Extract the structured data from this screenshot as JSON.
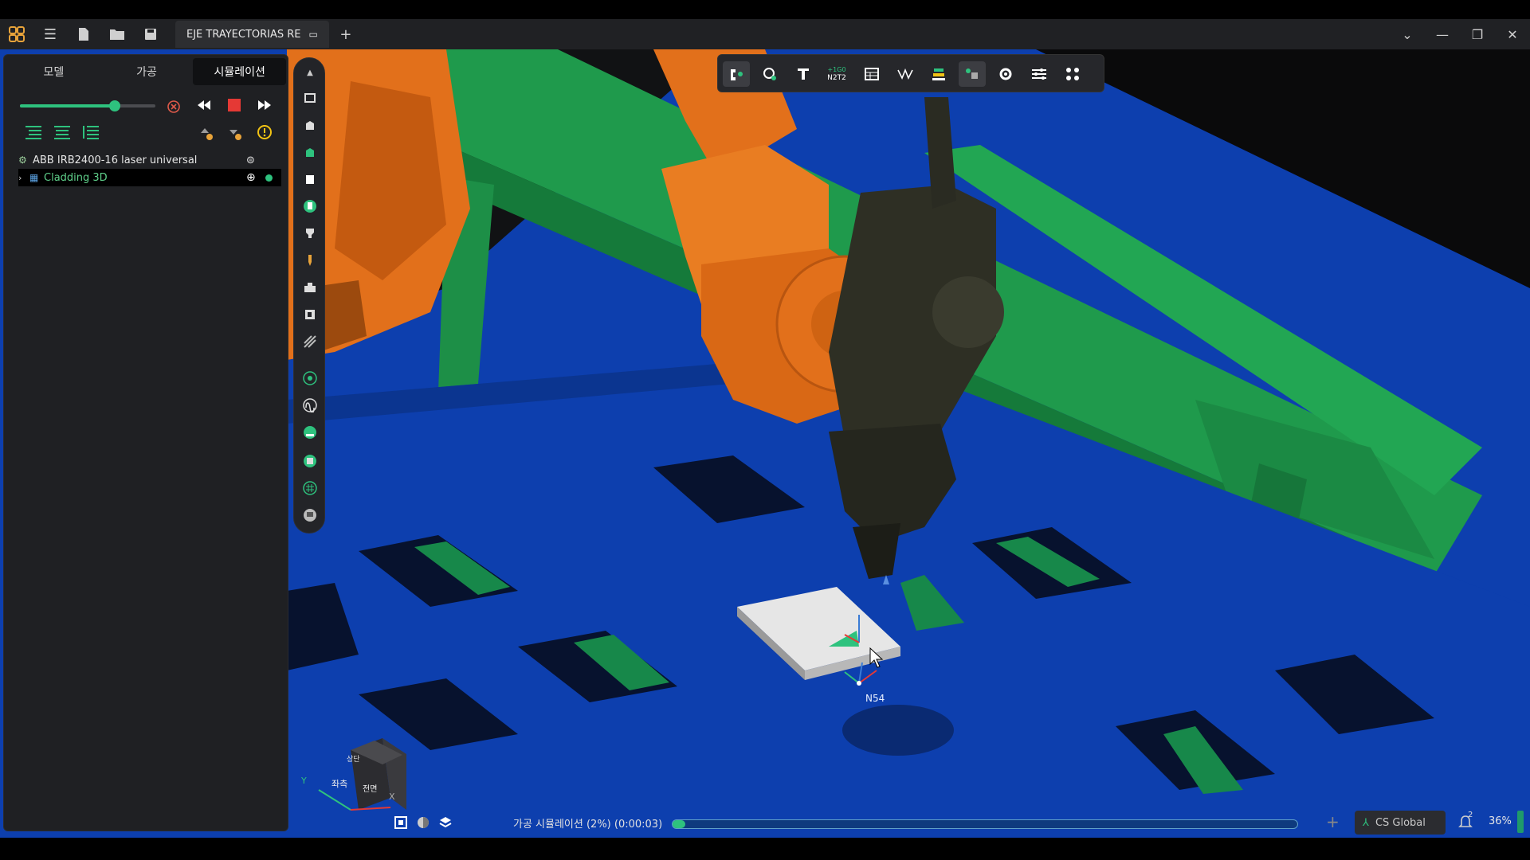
{
  "titlebar": {
    "tab_title": "EJE TRAYECTORIAS RE",
    "icons": [
      "app-logo-icon",
      "menu-icon",
      "new-file-icon",
      "open-folder-icon",
      "save-icon",
      "plus-icon"
    ]
  },
  "left_panel": {
    "tabs": [
      {
        "label": "모델",
        "active": false
      },
      {
        "label": "가공",
        "active": false
      },
      {
        "label": "시뮬레이션",
        "active": true
      }
    ],
    "slider_fraction": 0.7,
    "tree": [
      {
        "label": "ABB IRB2400-16 laser universal"
      },
      {
        "label": "Cladding 3D",
        "selected": true
      }
    ]
  },
  "viewport": {
    "node_label": "N54",
    "cube_faces": [
      "좌측",
      "전면",
      "상단"
    ],
    "axis_labels": {
      "y": "Y",
      "x": "X"
    }
  },
  "toolbar": {
    "nc_label": "N2T2",
    "nc_sublabel": "+1G0"
  },
  "statusbar": {
    "status_text": "가공 시뮬레이션 (2%) (0:00:03)",
    "progress_percent": 2,
    "cs_label": "CS Global",
    "notification_count": "2",
    "zoom": "36%"
  },
  "colors": {
    "accent": "#2ec27e",
    "table_blue": "#0d3fae",
    "robot_orange": "#e2701b",
    "frame_green": "#1f9a4c",
    "stop_red": "#e53935",
    "warning_yellow": "#f2c314"
  }
}
